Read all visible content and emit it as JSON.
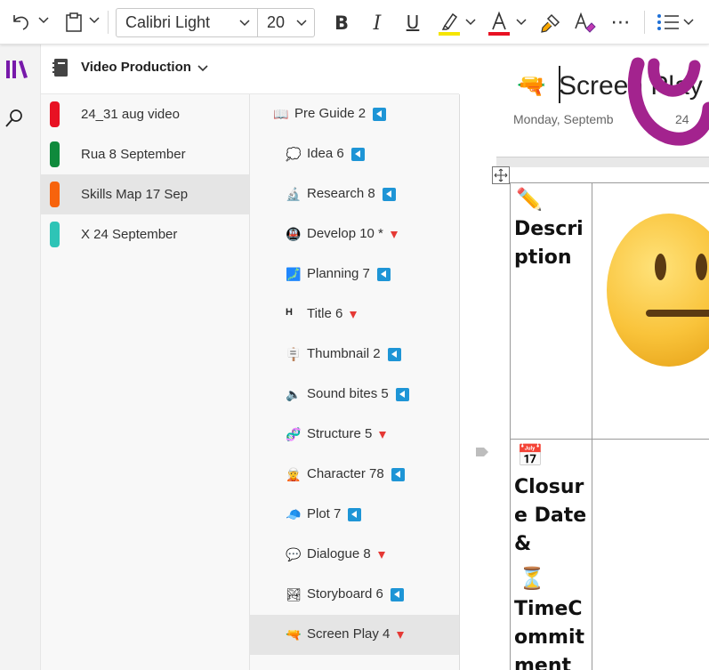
{
  "ribbon": {
    "font_name": "Calibri Light",
    "font_size": "20",
    "highlight_color": "#f5e500",
    "font_color": "#e81123",
    "icons": [
      "undo-icon",
      "clipboard-icon",
      "bold-icon",
      "italic-icon",
      "underline-icon",
      "highlighter-icon",
      "font-color-icon",
      "format-painter-icon",
      "clear-format-icon",
      "more-icon",
      "bullets-icon"
    ],
    "bold_label": "B",
    "italic_label": "I",
    "underline_label": "U",
    "font_color_label": "A",
    "more_label": "⋯"
  },
  "notebook": {
    "title": "Video Production"
  },
  "sections": [
    {
      "label": "24_31 aug video",
      "color": "#e81123"
    },
    {
      "label": "Rua 8 September",
      "color": "#0f8a3c"
    },
    {
      "label": "Skills Map 17 Sep",
      "color": "#f7630c",
      "selected": true
    },
    {
      "label": "X 24 September",
      "color": "#2ec4b6"
    }
  ],
  "pages": [
    {
      "label": "Pre Guide 2",
      "emoji": "📖",
      "marker": "blue",
      "indent": 0
    },
    {
      "label": "Idea 6",
      "emoji": "💭",
      "marker": "blue",
      "indent": 1
    },
    {
      "label": "Research 8",
      "emoji": "🔬",
      "marker": "blue",
      "indent": 1
    },
    {
      "label": "Develop 10 *",
      "emoji": "🚇",
      "marker": "red",
      "indent": 1
    },
    {
      "label": "Planning 7",
      "emoji": "🗾",
      "marker": "blue",
      "indent": 1
    },
    {
      "label": "Title 6",
      "emoji": "H",
      "marker": "red",
      "indent": 1
    },
    {
      "label": "Thumbnail 2",
      "emoji": "🪧",
      "marker": "blue",
      "indent": 1
    },
    {
      "label": "Sound bites 5",
      "emoji": "🔈",
      "marker": "blue",
      "indent": 1
    },
    {
      "label": "Structure 5",
      "emoji": "🧬",
      "marker": "red",
      "indent": 1
    },
    {
      "label": "Character 78",
      "emoji": "🧝",
      "marker": "blue",
      "indent": 1
    },
    {
      "label": "Plot 7",
      "emoji": "🧢",
      "marker": "blue",
      "indent": 1
    },
    {
      "label": "Dialogue 8",
      "emoji": "💬",
      "marker": "red",
      "indent": 1
    },
    {
      "label": "Storyboard 6",
      "emoji": "🏞",
      "marker": "blue",
      "indent": 1
    },
    {
      "label": "Screen Play 4",
      "emoji": "🔫",
      "marker": "red",
      "indent": 1,
      "selected": true
    }
  ],
  "canvas": {
    "title": "Screen Play",
    "date": "Monday, Septemb",
    "date_tail": "24",
    "cells": [
      {
        "emoji": "✏️",
        "text": "Description"
      },
      {
        "emoji": "📅",
        "text": "Closure Date &"
      },
      {
        "emoji": "⏳",
        "text": "TimeCommitment"
      }
    ],
    "face_emoji": "😐"
  }
}
